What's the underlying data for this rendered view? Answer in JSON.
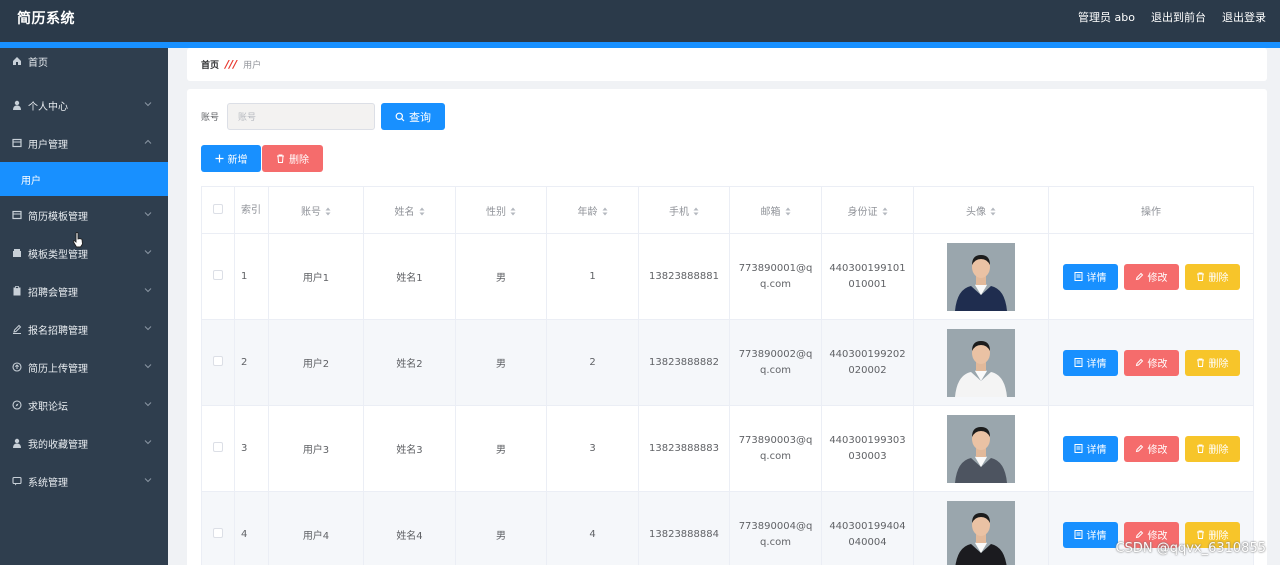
{
  "header": {
    "title": "简历系统",
    "user": "管理员 abo",
    "to_front": "退出到前台",
    "logout": "退出登录"
  },
  "sidebar": {
    "items": [
      {
        "label": "首页",
        "icon": "home-icon"
      },
      {
        "label": "个人中心",
        "icon": "user-icon"
      },
      {
        "label": "用户管理",
        "icon": "list-icon",
        "expanded": true
      },
      {
        "label": "简历模板管理",
        "icon": "list-icon"
      },
      {
        "label": "模板类型管理",
        "icon": "box-icon"
      },
      {
        "label": "招聘会管理",
        "icon": "clipboard-icon"
      },
      {
        "label": "报名招聘管理",
        "icon": "edit-icon"
      },
      {
        "label": "简历上传管理",
        "icon": "upload-icon"
      },
      {
        "label": "求职论坛",
        "icon": "compass-icon"
      },
      {
        "label": "我的收藏管理",
        "icon": "user-icon"
      },
      {
        "label": "系统管理",
        "icon": "message-icon"
      }
    ],
    "active_sub": "用户"
  },
  "breadcrumb": {
    "home": "首页",
    "current": "用户"
  },
  "search": {
    "label": "账号",
    "placeholder": "账号",
    "button": "查询"
  },
  "actions": {
    "add": "新增",
    "delete": "删除"
  },
  "table": {
    "headers": {
      "index": "索引",
      "account": "账号",
      "name": "姓名",
      "gender": "性别",
      "age": "年龄",
      "phone": "手机",
      "email": "邮箱",
      "id_card": "身份证",
      "avatar": "头像",
      "ops": "操作"
    },
    "rows": [
      {
        "index": "1",
        "account": "用户1",
        "name": "姓名1",
        "gender": "男",
        "age": "1",
        "phone": "13823888881",
        "email": "773890001@qq.com",
        "id_card": "440300199101010001",
        "suit": "#1f2d4f"
      },
      {
        "index": "2",
        "account": "用户2",
        "name": "姓名2",
        "gender": "男",
        "age": "2",
        "phone": "13823888882",
        "email": "773890002@qq.com",
        "id_card": "440300199202020002",
        "suit": "#f4f4f4"
      },
      {
        "index": "3",
        "account": "用户3",
        "name": "姓名3",
        "gender": "男",
        "age": "3",
        "phone": "13823888883",
        "email": "773890003@qq.com",
        "id_card": "440300199303030003",
        "suit": "#4d5460"
      },
      {
        "index": "4",
        "account": "用户4",
        "name": "姓名4",
        "gender": "男",
        "age": "4",
        "phone": "13823888884",
        "email": "773890004@qq.com",
        "id_card": "440300199404040004",
        "suit": "#1b1b1f"
      }
    ],
    "ops": {
      "detail": "详情",
      "edit": "修改",
      "delete": "删除"
    }
  },
  "watermark": "CSDN @qqvx_6310855",
  "colors": {
    "primary": "#1890ff",
    "danger": "#f56c6c",
    "warning": "#f7c52a",
    "sidebar": "#2f3e4e",
    "topbar": "#2b3a4a"
  }
}
